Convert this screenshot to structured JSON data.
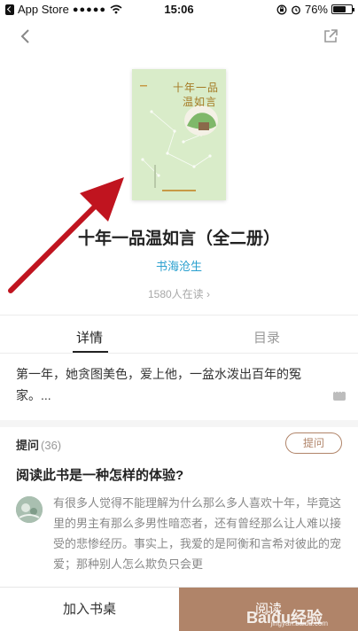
{
  "status_bar": {
    "back_app": "App Store",
    "signal": "●●●●●",
    "time": "15:06",
    "battery_text": "76%",
    "battery_level": 0.76
  },
  "nav": {
    "back_icon": "chevron-left-icon",
    "share_icon": "share-icon"
  },
  "book": {
    "cover_title_line1": "十年一品",
    "cover_title_line2": "温如言",
    "title": "十年一品温如言（全二册）",
    "author": "书海沧生",
    "readers": "1580人在读 ›"
  },
  "tabs": {
    "details": "详情",
    "toc": "目录"
  },
  "synopsis": "第一年，她贪图美色，爱上他，一盆水泼出百年的冤家。...",
  "qa": {
    "label": "提问",
    "count": "(36)",
    "ask_button": "提问",
    "question": "阅读此书是一种怎样的体验?",
    "answer": "有很多人觉得不能理解为什么那么多人喜欢十年，毕竟这里的男主有那么多男性暗恋者，还有曾经那么让人难以接受的悲惨经历。事实上，我爱的是阿衡和言希对彼此的宠爱；那种别人怎么欺负只会更"
  },
  "bottom": {
    "shelf_button": "加入书桌",
    "read_button": "阅读",
    "watermark": "Baidu经验",
    "watermark_sub": "jingyan.baidu.com"
  },
  "colors": {
    "accent": "#b08469",
    "author_link": "#2aa0cf",
    "arrow": "#c0141f",
    "cover_bg": "#d9ecc9"
  }
}
